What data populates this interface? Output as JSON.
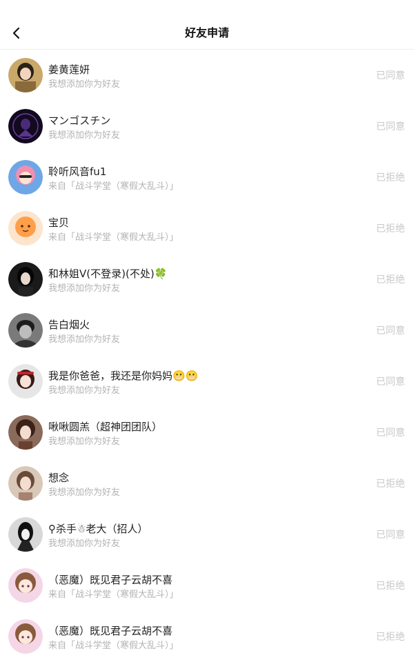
{
  "header": {
    "title": "好友申请",
    "back_icon": "chevron-left-icon"
  },
  "requests": [
    {
      "name": "姜黄莲妍",
      "message": "我想添加你为好友",
      "status": "已同意",
      "avatar": "avatar-girl-portrait"
    },
    {
      "name": "マンゴスチン",
      "message": "我想添加你为好友",
      "status": "已同意",
      "avatar": "avatar-dark-purple"
    },
    {
      "name": "聆听风音fu1",
      "message": "来自「战斗学堂（寒假大乱斗）」",
      "status": "已拒绝",
      "avatar": "avatar-anime-pink"
    },
    {
      "name": "宝贝",
      "message": "来自「战斗学堂（寒假大乱斗）」",
      "status": "已拒绝",
      "avatar": "avatar-orange-cartoon"
    },
    {
      "name": "和林姐V(不登录)(不处)🍀",
      "message": "我想添加你为好友",
      "status": "已拒绝",
      "avatar": "avatar-dark-girl"
    },
    {
      "name": "告白烟火",
      "message": "我想添加你为好友",
      "status": "已同意",
      "avatar": "avatar-bw-portrait"
    },
    {
      "name": "我是你爸爸，我还是你妈妈😬😬",
      "message": "我想添加你为好友",
      "status": "已同意",
      "avatar": "avatar-red-hair-girl"
    },
    {
      "name": "啾啾圆羔（超神团团队）",
      "message": "我想添加你为好友",
      "status": "已同意",
      "avatar": "avatar-doll-girl"
    },
    {
      "name": "想念",
      "message": "我想添加你为好友",
      "status": "已拒绝",
      "avatar": "avatar-photo-girl"
    },
    {
      "name": "⚲杀手☃老大（招人）",
      "message": "我想添加你为好友",
      "status": "已同意",
      "avatar": "avatar-bw-figure"
    },
    {
      "name": "（恶魔）既见君子云胡不喜",
      "message": "来自「战斗学堂（寒假大乱斗）」",
      "status": "已拒绝",
      "avatar": "avatar-anime-brown-hair"
    },
    {
      "name": "（恶魔）既见君子云胡不喜",
      "message": "来自「战斗学堂（寒假大乱斗）」",
      "status": "已拒绝",
      "avatar": "avatar-anime-brown-hair"
    }
  ]
}
